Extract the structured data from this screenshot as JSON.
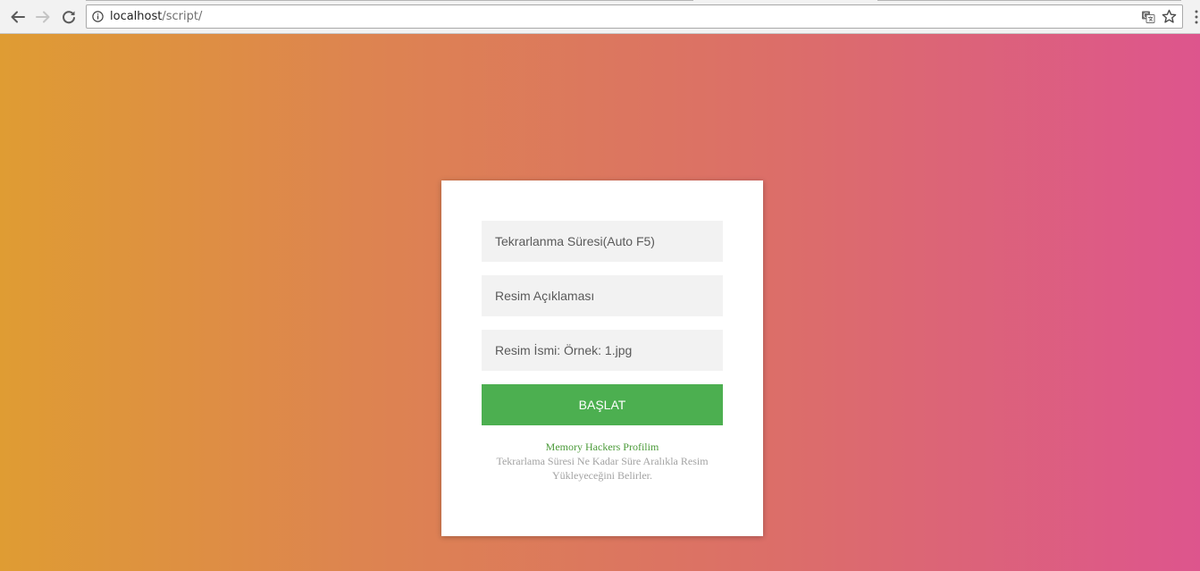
{
  "browser": {
    "url_host": "localhost",
    "url_path": "/script/"
  },
  "form": {
    "fields": [
      {
        "placeholder": "Tekrarlanma Süresi(Auto F5)",
        "value": ""
      },
      {
        "placeholder": "Resim Açıklaması",
        "value": ""
      },
      {
        "placeholder": "Resim İsmi: Örnek: 1.jpg",
        "value": ""
      }
    ],
    "submit_label": "BAŞLAT",
    "profile_link": "Memory Hackers Profilim",
    "note_line1": "Tekrarlama Süresi Ne Kadar Süre Aralıkla Resim",
    "note_line2": "Yükleyeceğini Belirler."
  },
  "colors": {
    "gradient_start": "#df9c33",
    "gradient_end": "#dd558d",
    "button": "#4caf50",
    "link": "#4c9b3a"
  }
}
